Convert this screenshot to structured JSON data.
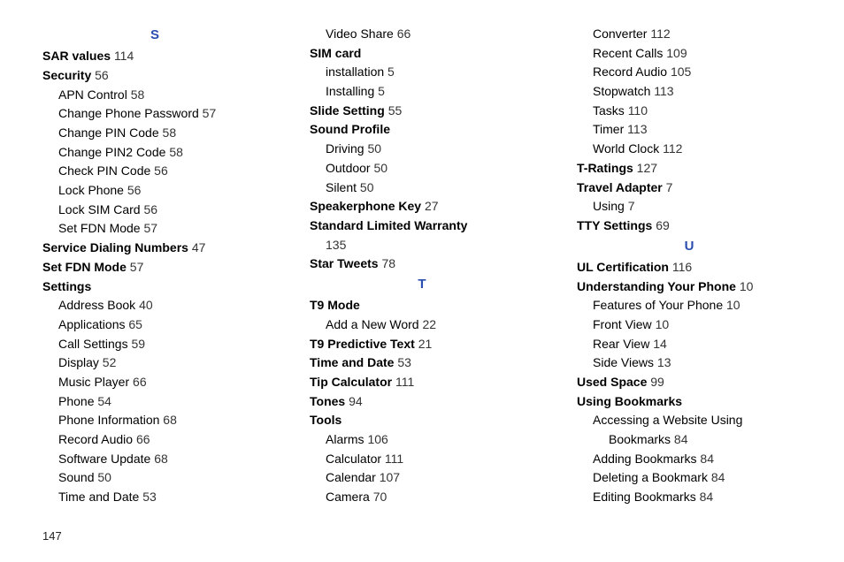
{
  "pageNumber": "147",
  "columns": [
    [
      {
        "type": "head",
        "text": "S"
      },
      {
        "indent": 1,
        "bold": true,
        "label": "SAR values",
        "page": "114"
      },
      {
        "indent": 1,
        "bold": true,
        "label": "Security",
        "page": "56"
      },
      {
        "indent": 2,
        "label": "APN Control",
        "page": "58"
      },
      {
        "indent": 2,
        "label": "Change Phone Password",
        "page": "57"
      },
      {
        "indent": 2,
        "label": "Change PIN Code",
        "page": "58"
      },
      {
        "indent": 2,
        "label": "Change PIN2 Code",
        "page": "58"
      },
      {
        "indent": 2,
        "label": "Check PIN Code",
        "page": "56"
      },
      {
        "indent": 2,
        "label": "Lock Phone",
        "page": "56"
      },
      {
        "indent": 2,
        "label": "Lock SIM Card",
        "page": "56"
      },
      {
        "indent": 2,
        "label": "Set FDN Mode",
        "page": "57"
      },
      {
        "indent": 1,
        "bold": true,
        "label": "Service Dialing Numbers",
        "page": "47"
      },
      {
        "indent": 1,
        "bold": true,
        "label": "Set FDN Mode",
        "page": "57"
      },
      {
        "indent": 1,
        "bold": true,
        "label": "Settings",
        "page": ""
      },
      {
        "indent": 2,
        "label": "Address Book",
        "page": "40"
      },
      {
        "indent": 2,
        "label": "Applications",
        "page": "65"
      },
      {
        "indent": 2,
        "label": "Call Settings",
        "page": "59"
      },
      {
        "indent": 2,
        "label": "Display",
        "page": "52"
      },
      {
        "indent": 2,
        "label": "Music Player",
        "page": "66"
      },
      {
        "indent": 2,
        "label": "Phone",
        "page": "54"
      },
      {
        "indent": 2,
        "label": "Phone Information",
        "page": "68"
      },
      {
        "indent": 2,
        "label": "Record Audio",
        "page": "66"
      },
      {
        "indent": 2,
        "label": "Software Update",
        "page": "68"
      },
      {
        "indent": 2,
        "label": "Sound",
        "page": "50"
      },
      {
        "indent": 2,
        "label": "Time and Date",
        "page": "53"
      }
    ],
    [
      {
        "indent": 2,
        "label": "Video Share",
        "page": "66"
      },
      {
        "indent": 1,
        "bold": true,
        "label": "SIM card",
        "page": ""
      },
      {
        "indent": 2,
        "label": "installation",
        "page": "5"
      },
      {
        "indent": 2,
        "label": "Installing",
        "page": "5"
      },
      {
        "indent": 1,
        "bold": true,
        "label": "Slide Setting",
        "page": "55"
      },
      {
        "indent": 1,
        "bold": true,
        "label": "Sound Profile",
        "page": ""
      },
      {
        "indent": 2,
        "label": "Driving",
        "page": "50"
      },
      {
        "indent": 2,
        "label": "Outdoor",
        "page": "50"
      },
      {
        "indent": 2,
        "label": "Silent",
        "page": "50"
      },
      {
        "indent": 1,
        "bold": true,
        "label": "Speakerphone Key",
        "page": "27"
      },
      {
        "indent": 1,
        "bold": true,
        "label": "Standard Limited Warranty",
        "page": ""
      },
      {
        "indent": 2,
        "label": "",
        "page": "135"
      },
      {
        "indent": 1,
        "bold": true,
        "label": "Star Tweets",
        "page": "78"
      },
      {
        "type": "head",
        "text": "T"
      },
      {
        "indent": 1,
        "bold": true,
        "label": "T9 Mode",
        "page": ""
      },
      {
        "indent": 2,
        "label": "Add a New Word",
        "page": "22"
      },
      {
        "indent": 1,
        "bold": true,
        "label": "T9 Predictive Text",
        "page": "21"
      },
      {
        "indent": 1,
        "bold": true,
        "label": "Time and Date",
        "page": "53"
      },
      {
        "indent": 1,
        "bold": true,
        "label": "Tip Calculator",
        "page": "111"
      },
      {
        "indent": 1,
        "bold": true,
        "label": "Tones",
        "page": "94"
      },
      {
        "indent": 1,
        "bold": true,
        "label": "Tools",
        "page": ""
      },
      {
        "indent": 2,
        "label": "Alarms",
        "page": "106"
      },
      {
        "indent": 2,
        "label": "Calculator",
        "page": "111"
      },
      {
        "indent": 2,
        "label": "Calendar",
        "page": "107"
      },
      {
        "indent": 2,
        "label": "Camera",
        "page": "70"
      }
    ],
    [
      {
        "indent": 2,
        "label": "Converter",
        "page": "112"
      },
      {
        "indent": 2,
        "label": "Recent Calls",
        "page": "109"
      },
      {
        "indent": 2,
        "label": "Record Audio",
        "page": "105"
      },
      {
        "indent": 2,
        "label": "Stopwatch",
        "page": "113"
      },
      {
        "indent": 2,
        "label": "Tasks",
        "page": "110"
      },
      {
        "indent": 2,
        "label": "Timer",
        "page": "113"
      },
      {
        "indent": 2,
        "label": "World Clock",
        "page": "112"
      },
      {
        "indent": 1,
        "bold": true,
        "label": "T-Ratings",
        "page": "127"
      },
      {
        "indent": 1,
        "bold": true,
        "label": "Travel Adapter",
        "page": "7"
      },
      {
        "indent": 2,
        "label": "Using",
        "page": "7"
      },
      {
        "indent": 1,
        "bold": true,
        "label": "TTY Settings",
        "page": "69"
      },
      {
        "type": "head",
        "text": "U"
      },
      {
        "indent": 1,
        "bold": true,
        "label": "UL Certification",
        "page": "116"
      },
      {
        "indent": 1,
        "bold": true,
        "label": "Understanding Your Phone",
        "page": "10"
      },
      {
        "indent": 2,
        "label": "Features of Your Phone",
        "page": "10"
      },
      {
        "indent": 2,
        "label": "Front View",
        "page": "10"
      },
      {
        "indent": 2,
        "label": "Rear View",
        "page": "14"
      },
      {
        "indent": 2,
        "label": "Side Views",
        "page": "13"
      },
      {
        "indent": 1,
        "bold": true,
        "label": "Used Space",
        "page": "99"
      },
      {
        "indent": 1,
        "bold": true,
        "label": "Using Bookmarks",
        "page": ""
      },
      {
        "indent": 2,
        "label": "Accessing a Website Using",
        "page": ""
      },
      {
        "indent": 3,
        "label": "Bookmarks",
        "page": "84"
      },
      {
        "indent": 2,
        "label": "Adding Bookmarks",
        "page": "84"
      },
      {
        "indent": 2,
        "label": "Deleting a Bookmark",
        "page": "84"
      },
      {
        "indent": 2,
        "label": "Editing Bookmarks",
        "page": "84"
      }
    ]
  ]
}
